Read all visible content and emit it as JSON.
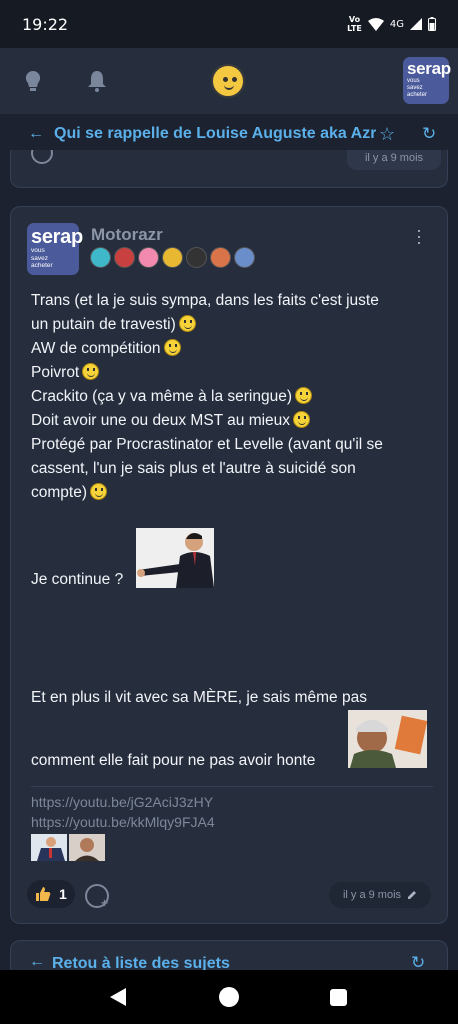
{
  "status_bar": {
    "time": "19:22",
    "network_label": "4G",
    "volte_top": "Vo",
    "volte_bottom": "LTE"
  },
  "app_bar": {
    "logo": {
      "main": "serap",
      "line1": "vous",
      "line2": "savez",
      "line3": "acheter"
    }
  },
  "topic": {
    "title": "Qui se rappelle de Louise Auguste aka Azr"
  },
  "previous_post": {
    "date": "il y a 9 mois"
  },
  "post": {
    "avatar": {
      "main": "serap",
      "line1": "vous",
      "line2": "savez",
      "line3": "acheter"
    },
    "author": "Motorazr",
    "badge_colors": [
      "#3fb8c9",
      "#c94040",
      "#f28ab0",
      "#e8b832",
      "#333333",
      "#d9734a",
      "#6a8ec9"
    ],
    "lines": [
      "Trans (et la je suis sympa, dans les faits c'est juste",
      "un putain de travesti)",
      "AW de compétition",
      "Poivrot",
      "Crackito (ça y va même à la seringue)",
      "Doit avoir une ou deux MST au mieux",
      "Protégé par Procrastinator et Levelle (avant qu'il se",
      "cassent, l'un je sais plus et l'autre à suicidé son",
      "compte)"
    ],
    "continue": "Je continue ?",
    "mother_line1": "Et en plus il vit avec sa MÈRE, je sais même pas",
    "mother_line2": "comment elle fait pour ne pas avoir honte",
    "links": [
      "https://youtu.be/jG2AciJ3zHY",
      "https://youtu.be/kkMlqy9FJA4"
    ],
    "likes": "1",
    "date": "il y a 9 mois"
  },
  "footer_nav": {
    "back_label": "Retou à liste des sujets"
  }
}
